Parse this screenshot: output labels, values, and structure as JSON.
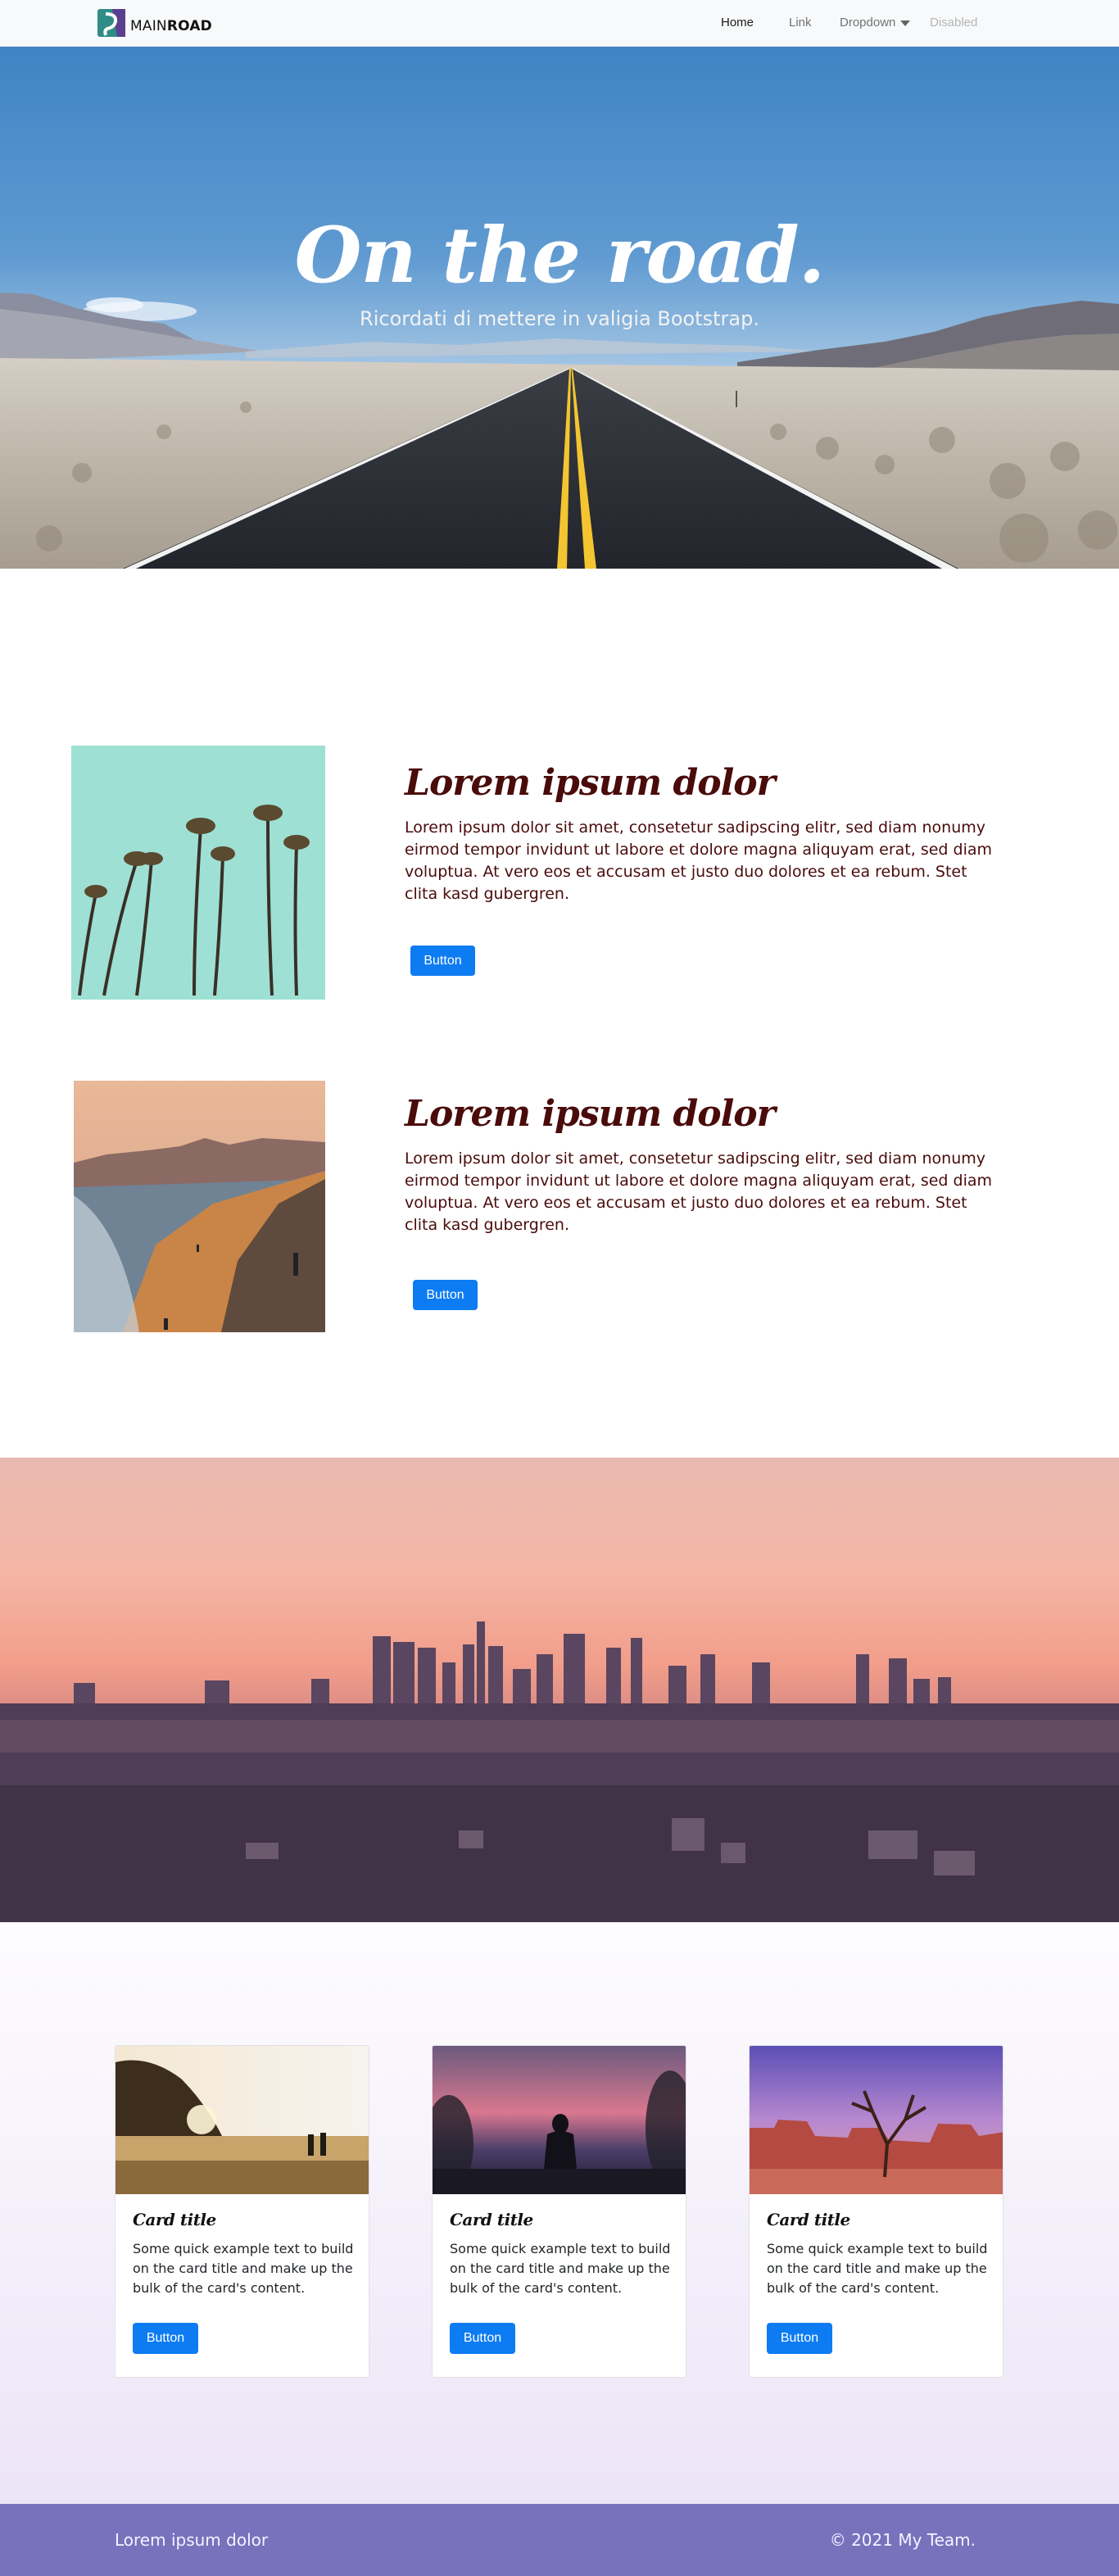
{
  "navbar": {
    "brand_light": "MAIN",
    "brand_bold": "ROAD",
    "items": [
      {
        "label": "Home"
      },
      {
        "label": "Link"
      },
      {
        "label": "Dropdown"
      },
      {
        "label": "Disabled"
      }
    ]
  },
  "hero": {
    "title": "On the road.",
    "subtitle": "Ricordati di mettere in valigia Bootstrap."
  },
  "features": [
    {
      "title": "Lorem ipsum dolor",
      "text": "Lorem ipsum dolor sit amet, consetetur sadipscing elitr, sed diam nonumy eirmod tempor invidunt ut labore et dolore magna aliquyam erat, sed diam voluptua. At vero eos et accusam et justo duo dolores et ea rebum. Stet clita kasd gubergren.",
      "button": "Button"
    },
    {
      "title": "Lorem ipsum dolor",
      "text": "Lorem ipsum dolor sit amet, consetetur sadipscing elitr, sed diam nonumy eirmod tempor invidunt ut labore et dolore magna aliquyam erat, sed diam voluptua. At vero eos et accusam et justo duo dolores et ea rebum. Stet clita kasd gubergren.",
      "button": "Button"
    }
  ],
  "cards": [
    {
      "title": "Card title",
      "text": "Some quick example text to build on the card title and make up the bulk of the card's content.",
      "button": "Button"
    },
    {
      "title": "Card title",
      "text": "Some quick example text to build on the card title and make up the bulk of the card's content.",
      "button": "Button"
    },
    {
      "title": "Card title",
      "text": "Some quick example text to build on the card title and make up the bulk of the card's content.",
      "button": "Button"
    }
  ],
  "footer": {
    "left": "Lorem ipsum dolor",
    "right": "© 2021 My Team."
  },
  "colors": {
    "accent": "#0d7cf2",
    "heading": "#4a0b0b",
    "footer_bg": "#7872bd"
  }
}
